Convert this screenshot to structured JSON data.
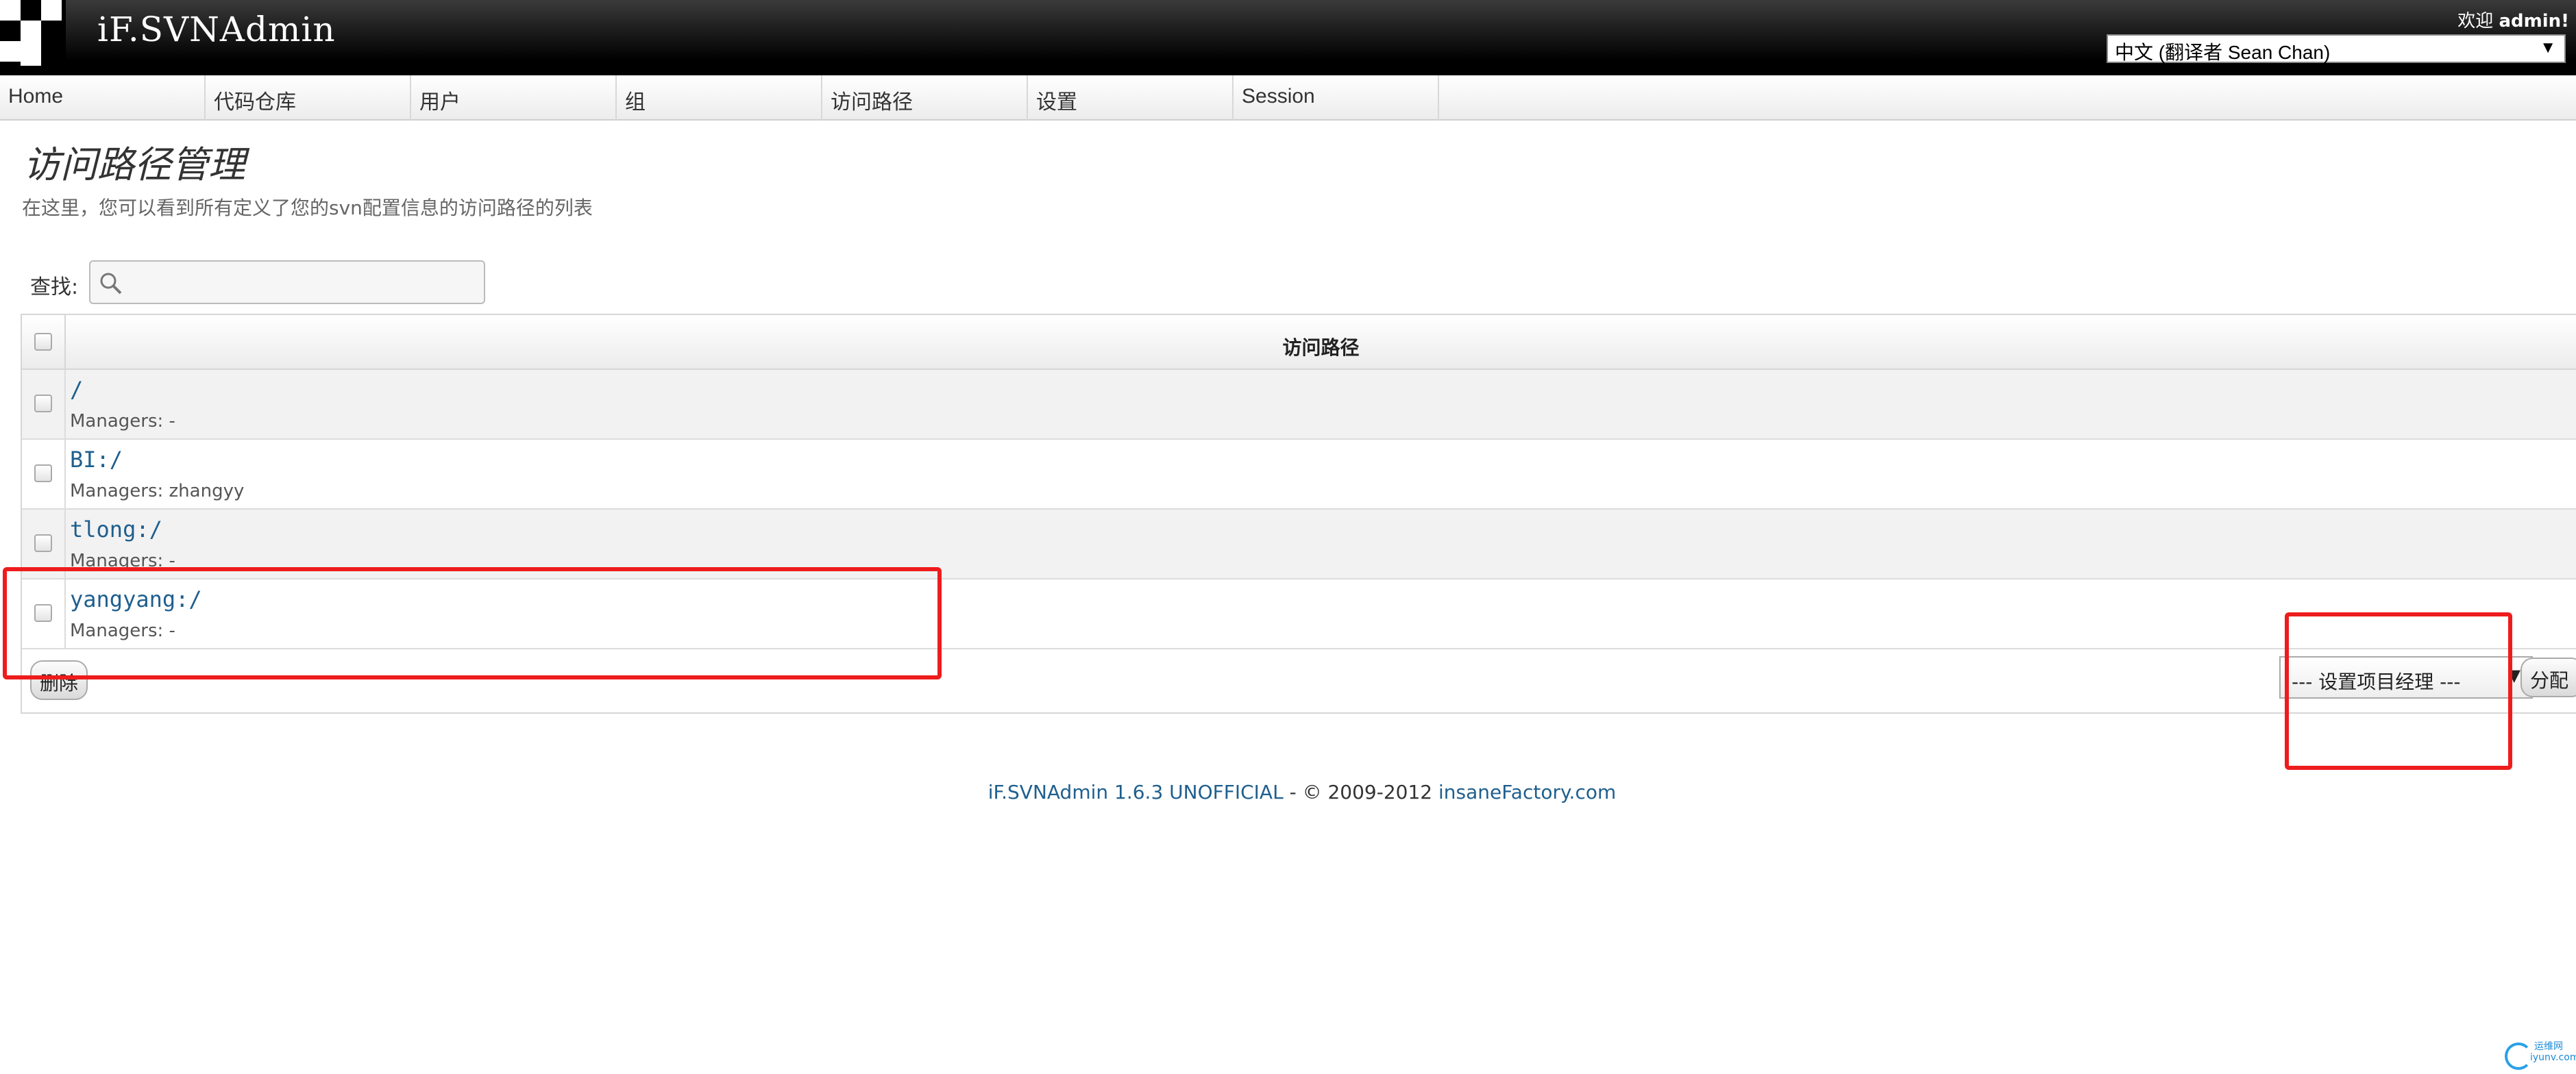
{
  "header": {
    "app_title": "iF.SVNAdmin",
    "welcome_prefix": "欢迎",
    "username": "admin!",
    "language": "中文 (翻译者 Sean Chan)"
  },
  "nav": {
    "items": [
      {
        "label": "Home"
      },
      {
        "label": "代码仓库"
      },
      {
        "label": "用户"
      },
      {
        "label": "组"
      },
      {
        "label": "访问路径"
      },
      {
        "label": "设置"
      },
      {
        "label": "Session"
      }
    ]
  },
  "page": {
    "title": "访问路径管理",
    "description": "在这里，您可以看到所有定义了您的svn配置信息的访问路径的列表"
  },
  "search": {
    "label": "查找:",
    "value": ""
  },
  "table": {
    "header": "访问路径",
    "rows": [
      {
        "path": "/",
        "managers": "Managers: -"
      },
      {
        "path": "BI:/",
        "managers": "Managers: zhangyy"
      },
      {
        "path": "tlong:/",
        "managers": "Managers: -"
      },
      {
        "path": "yangyang:/",
        "managers": "Managers: -"
      }
    ],
    "delete_label": "删除",
    "manager_select": "--- 设置项目经理 ---",
    "assign_label": "分配"
  },
  "footer": {
    "product": "iF.SVNAdmin 1.6.3 UNOFFICIAL",
    "copyright": " - © 2009-2012 ",
    "company": "insaneFactory.com"
  },
  "watermark": {
    "line1": "运维网",
    "line2": "iyunv.com"
  },
  "colors": {
    "header_bg": "#000000",
    "link": "#1f5f8e",
    "annotation": "#ee1c1c"
  }
}
